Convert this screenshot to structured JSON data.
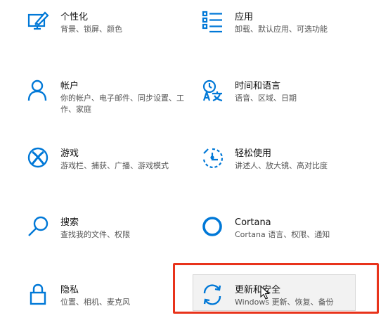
{
  "settings": {
    "items": [
      {
        "title": "个性化",
        "desc": "背景、锁屏、颜色",
        "icon": "personalization-icon"
      },
      {
        "title": "应用",
        "desc": "卸载、默认应用、可选功能",
        "icon": "apps-icon"
      },
      {
        "title": "帐户",
        "desc": "你的帐户、电子邮件、同步设置、工作、家庭",
        "icon": "account-icon"
      },
      {
        "title": "时间和语言",
        "desc": "语音、区域、日期",
        "icon": "time-language-icon"
      },
      {
        "title": "游戏",
        "desc": "游戏栏、捕获、广播、游戏模式",
        "icon": "xbox-icon"
      },
      {
        "title": "轻松使用",
        "desc": "讲述人、放大镜、高对比度",
        "icon": "ease-of-access-icon"
      },
      {
        "title": "搜索",
        "desc": "查找我的文件、权限",
        "icon": "search-icon"
      },
      {
        "title": "Cortana",
        "desc": "Cortana 语言、权限、通知",
        "icon": "cortana-icon"
      },
      {
        "title": "隐私",
        "desc": "位置、相机、麦克风",
        "icon": "lock-icon"
      },
      {
        "title": "更新和安全",
        "desc": "Windows 更新、恢复、备份",
        "icon": "sync-icon"
      }
    ]
  },
  "colors": {
    "accent": "#0078d7",
    "highlight": "#e8331b"
  }
}
